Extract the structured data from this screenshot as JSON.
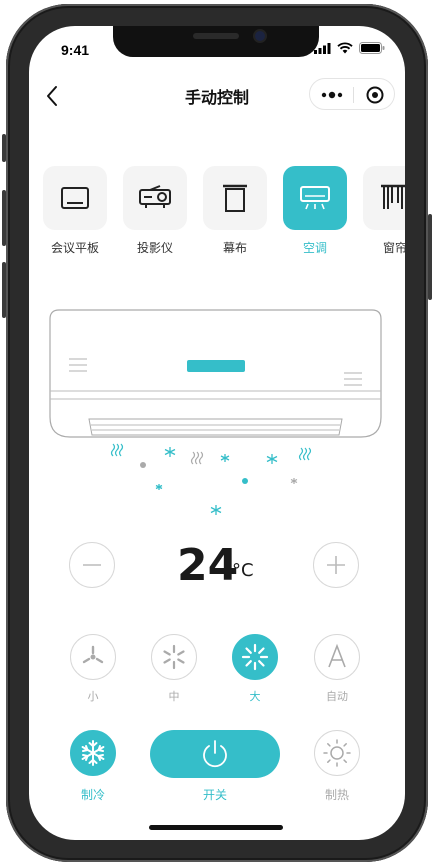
{
  "status_bar": {
    "time": "9:41"
  },
  "nav": {
    "title": "手动控制"
  },
  "devices": [
    {
      "label": "会议平板",
      "icon": "tablet-icon",
      "active": false
    },
    {
      "label": "投影仪",
      "icon": "projector-icon",
      "active": false
    },
    {
      "label": "幕布",
      "icon": "screen-curtain-icon",
      "active": false
    },
    {
      "label": "空调",
      "icon": "air-conditioner-icon",
      "active": true
    },
    {
      "label": "窗帘",
      "icon": "window-curtain-icon",
      "active": false
    }
  ],
  "temperature": {
    "value": "24",
    "unit": "°C"
  },
  "fan_speeds": [
    {
      "label": "小",
      "active": false
    },
    {
      "label": "中",
      "active": false
    },
    {
      "label": "大",
      "active": true
    },
    {
      "label": "自动",
      "active": false
    }
  ],
  "modes": {
    "cool_label": "制冷",
    "power_label": "开关",
    "heat_label": "制热"
  },
  "colors": {
    "accent": "#35bec9",
    "inactive": "#aaaaaa",
    "tile_bg": "#f4f4f4"
  }
}
